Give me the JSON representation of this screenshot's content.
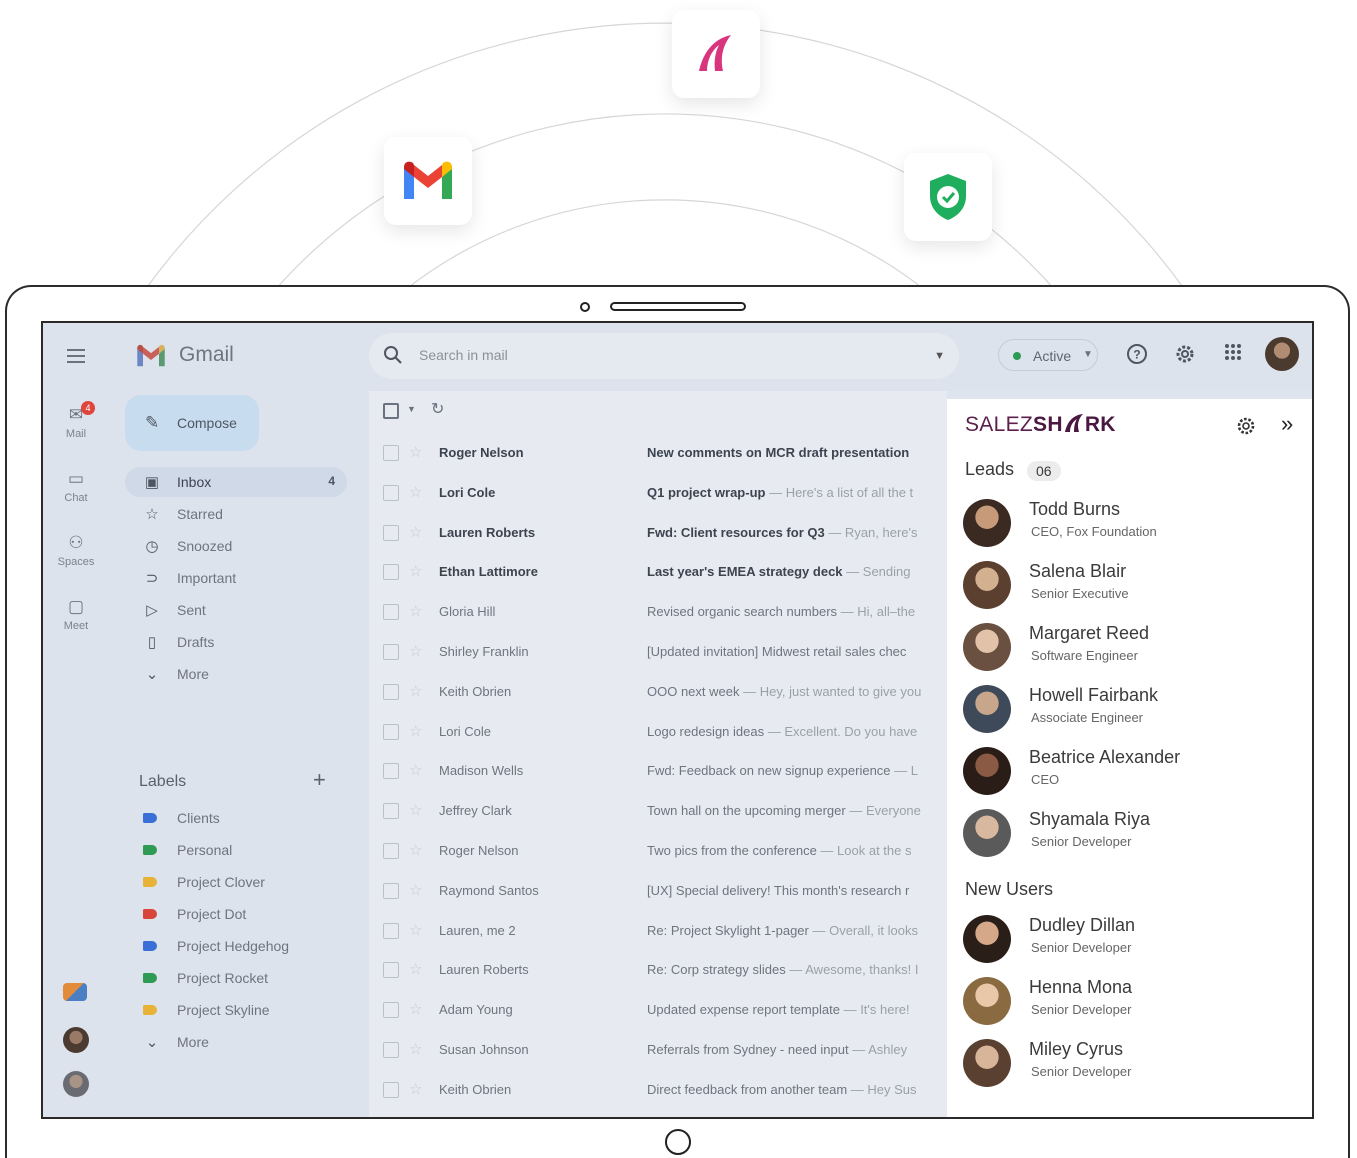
{
  "gmail": {
    "title": "Gmail",
    "search_placeholder": "Search in mail",
    "status": "Active",
    "compose": "Compose",
    "rail": [
      {
        "label": "Mail",
        "badge": "4"
      },
      {
        "label": "Chat"
      },
      {
        "label": "Spaces"
      },
      {
        "label": "Meet"
      }
    ],
    "nav": [
      {
        "label": "Inbox",
        "count": "4"
      },
      {
        "label": "Starred"
      },
      {
        "label": "Snoozed"
      },
      {
        "label": "Important"
      },
      {
        "label": "Sent"
      },
      {
        "label": "Drafts"
      },
      {
        "label": "More"
      }
    ],
    "labels_title": "Labels",
    "labels": [
      {
        "name": "Clients",
        "color": "#3a6fd8"
      },
      {
        "name": "Personal",
        "color": "#2f9a52"
      },
      {
        "name": "Project Clover",
        "color": "#e8b238"
      },
      {
        "name": "Project Dot",
        "color": "#d8453b"
      },
      {
        "name": "Project Hedgehog",
        "color": "#3a6fd8"
      },
      {
        "name": "Project Rocket",
        "color": "#2f9a52"
      },
      {
        "name": "Project Skyline",
        "color": "#e8b238"
      }
    ],
    "labels_more": "More",
    "emails": [
      {
        "from": "Roger Nelson",
        "subject": "New comments on MCR draft presentation",
        "preview": "",
        "unread": true
      },
      {
        "from": "Lori Cole",
        "subject": "Q1 project wrap-up",
        "preview": " — Here's a list of all the t",
        "unread": true
      },
      {
        "from": "Lauren Roberts",
        "subject": "Fwd: Client resources for Q3",
        "preview": " — Ryan, here's",
        "unread": true
      },
      {
        "from": "Ethan Lattimore",
        "subject": "Last year's EMEA strategy deck",
        "preview": " — Sending",
        "unread": true
      },
      {
        "from": "Gloria Hill",
        "subject": "Revised organic search numbers",
        "preview": " — Hi, all–the",
        "unread": false
      },
      {
        "from": "Shirley Franklin",
        "subject": "[Updated invitation] Midwest retail sales chec",
        "preview": "",
        "unread": false
      },
      {
        "from": "Keith Obrien",
        "subject": "OOO next week",
        "preview": " — Hey, just wanted to give you",
        "unread": false
      },
      {
        "from": "Lori Cole",
        "subject": "Logo redesign ideas",
        "preview": " — Excellent. Do you have",
        "unread": false
      },
      {
        "from": "Madison Wells",
        "subject": "Fwd: Feedback on new signup experience",
        "preview": " — L",
        "unread": false
      },
      {
        "from": "Jeffrey Clark",
        "subject": "Town hall on the upcoming merger",
        "preview": " — Everyone",
        "unread": false
      },
      {
        "from": "Roger Nelson",
        "subject": "Two pics from the conference",
        "preview": " — Look at the s",
        "unread": false
      },
      {
        "from": "Raymond Santos",
        "subject": "[UX] Special delivery! This month's research r",
        "preview": "",
        "unread": false
      },
      {
        "from": "Lauren, me  2",
        "subject": "Re: Project Skylight 1-pager",
        "preview": " — Overall, it looks",
        "unread": false
      },
      {
        "from": "Lauren Roberts",
        "subject": "Re: Corp strategy slides",
        "preview": " — Awesome, thanks! I",
        "unread": false
      },
      {
        "from": "Adam Young",
        "subject": "Updated expense report template",
        "preview": " — It's here!",
        "unread": false
      },
      {
        "from": "Susan Johnson",
        "subject": "Referrals from Sydney - need input",
        "preview": " — Ashley",
        "unread": false
      },
      {
        "from": "Keith Obrien",
        "subject": "Direct feedback from another team",
        "preview": " — Hey Sus",
        "unread": false
      }
    ]
  },
  "panel": {
    "brand_light": "SALEZ",
    "brand_bold": "SH",
    "brand_tail": "RK",
    "leads_title": "Leads",
    "leads_count": "06",
    "leads": [
      {
        "name": "Todd Burns",
        "role": "CEO, Fox Foundation"
      },
      {
        "name": "Salena Blair",
        "role": "Senior Executive"
      },
      {
        "name": "Margaret Reed",
        "role": "Software Engineer"
      },
      {
        "name": "Howell Fairbank",
        "role": "Associate Engineer"
      },
      {
        "name": "Beatrice Alexander",
        "role": "CEO"
      },
      {
        "name": "Shyamala Riya",
        "role": "Senior Developer"
      }
    ],
    "new_users_title": "New Users",
    "new_users": [
      {
        "name": "Dudley Dillan",
        "role": "Senior Developer"
      },
      {
        "name": "Henna Mona",
        "role": "Senior Developer"
      },
      {
        "name": "Miley Cyrus",
        "role": "Senior Developer"
      }
    ]
  },
  "colors": {
    "brand_pink": "#d9347e",
    "shield_green": "#1fae5d",
    "panel_brand": "#4a1840"
  }
}
